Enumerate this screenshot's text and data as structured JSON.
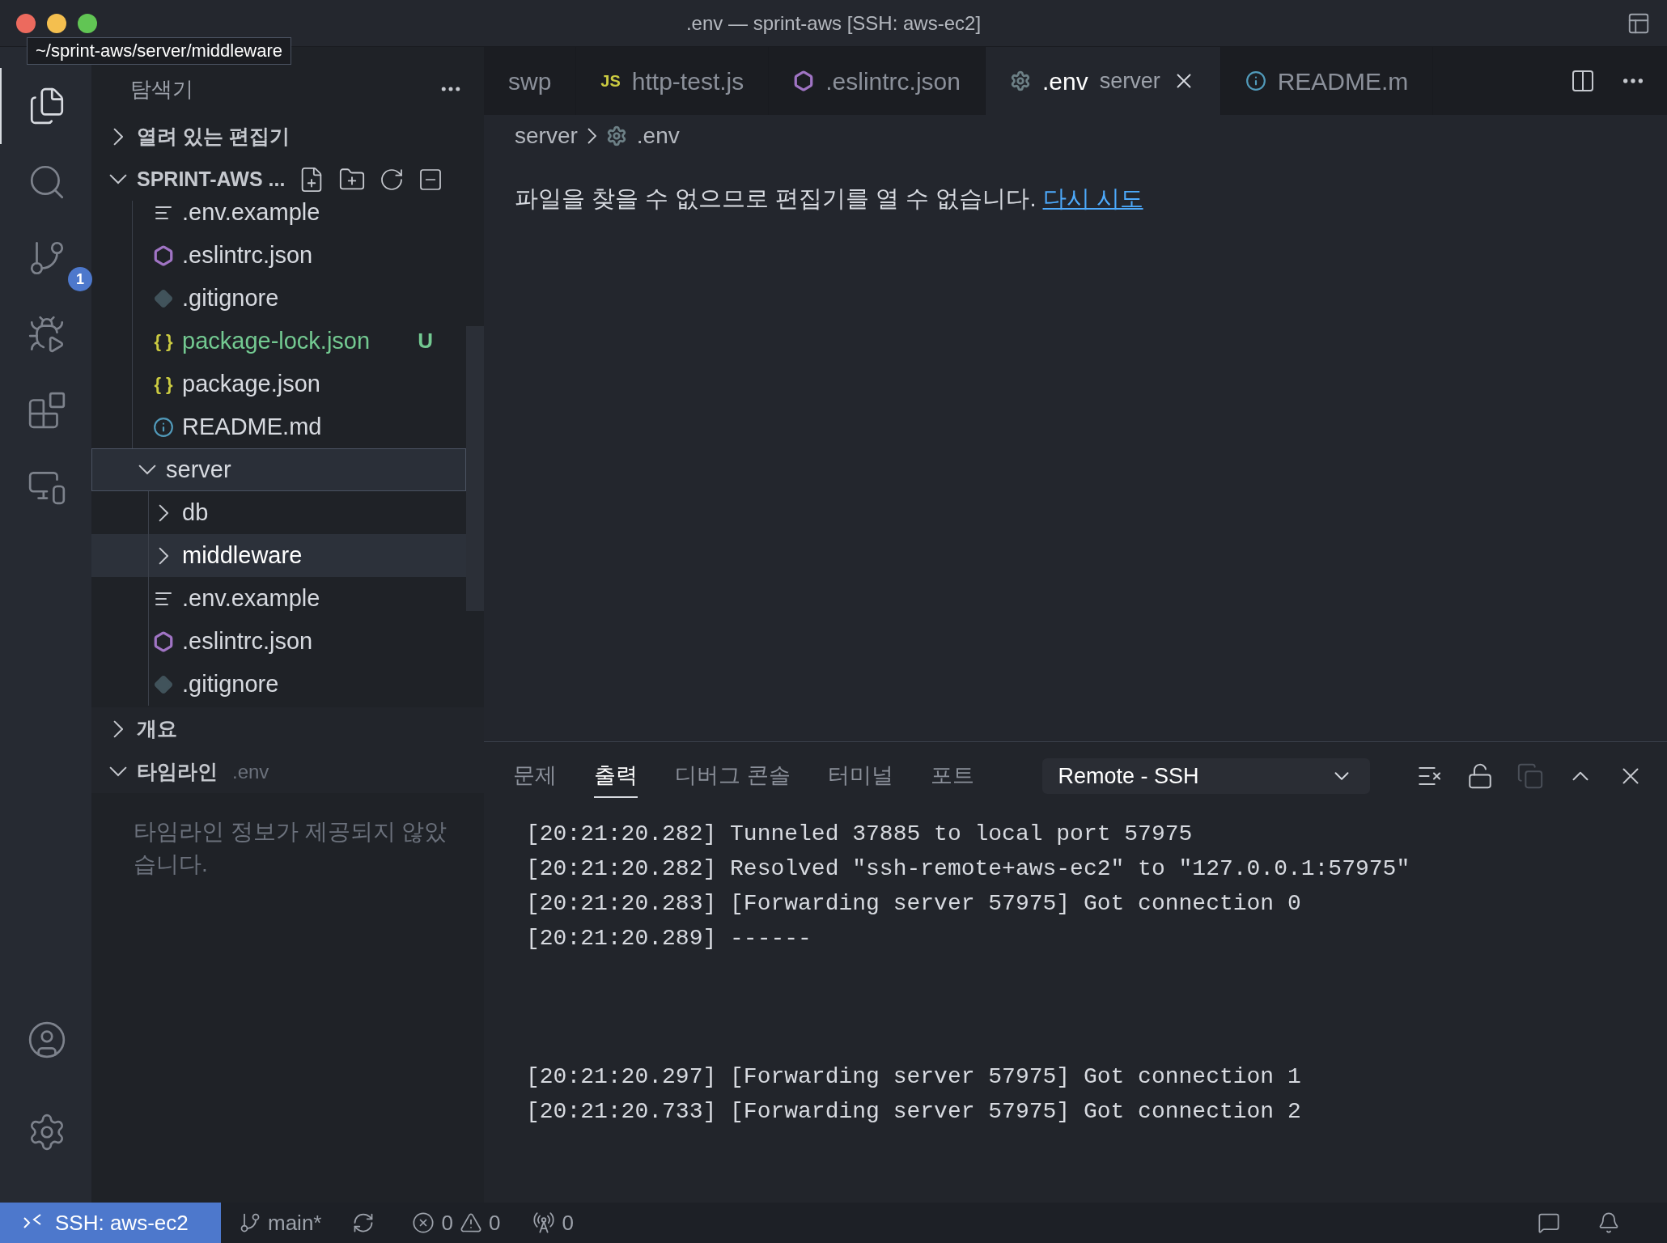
{
  "window": {
    "title": ".env — sprint-aws [SSH: aws-ec2]"
  },
  "tooltip": {
    "text": "~/sprint-aws/server/middleware"
  },
  "activity_bar": {
    "items": [
      {
        "kind": "explorer",
        "selected": true
      },
      {
        "kind": "search",
        "selected": false
      },
      {
        "kind": "source_control",
        "selected": false,
        "badge": "1"
      },
      {
        "kind": "run_debug",
        "selected": false
      },
      {
        "kind": "extensions",
        "selected": false
      },
      {
        "kind": "remote",
        "selected": false
      }
    ],
    "bottom": [
      {
        "kind": "account"
      },
      {
        "kind": "settings"
      }
    ]
  },
  "sidebar": {
    "title": "탐색기",
    "open_editors": {
      "label": "열려 있는 편집기",
      "expanded": false
    },
    "explorer": {
      "label": "SPRINT-AWS ...",
      "expanded": true,
      "partial_children": [
        {
          "name": ".env.example",
          "kind": "text",
          "selected": false,
          "focused": false
        },
        {
          "name": ".eslintrc.json",
          "kind": "eslint",
          "selected": false,
          "focused": false
        },
        {
          "name": ".gitignore",
          "kind": "git",
          "selected": false,
          "focused": false
        },
        {
          "name": "package-lock.json",
          "kind": "json",
          "icon_text": "{ }",
          "decoration": "U",
          "selected": false,
          "focused": false
        },
        {
          "name": "package.json",
          "kind": "json",
          "icon_text": "{ }",
          "selected": false,
          "focused": false
        },
        {
          "name": "README.md",
          "kind": "info",
          "selected": false,
          "focused": false
        }
      ],
      "tree": [
        {
          "name": "server",
          "kind": "folder",
          "expanded": true,
          "selected": false,
          "focused": true,
          "children": [
            {
              "name": "db",
              "kind": "folder",
              "expanded": false,
              "selected": false,
              "focused": false
            },
            {
              "name": "middleware",
              "kind": "folder",
              "expanded": false,
              "selected": true,
              "focused": false
            },
            {
              "name": ".env.example",
              "kind": "text",
              "selected": false,
              "focused": false
            },
            {
              "name": ".eslintrc.json",
              "kind": "eslint",
              "selected": false,
              "focused": false
            },
            {
              "name": ".gitignore",
              "kind": "git",
              "selected": false,
              "focused": false
            }
          ]
        }
      ]
    },
    "outline": {
      "label": "개요",
      "expanded": false
    },
    "timeline": {
      "label": "타임라인",
      "expanded": true,
      "subtitle": ".env",
      "message": "타임라인 정보가 제공되지 않았습니다."
    }
  },
  "tabs": [
    {
      "label": "swp",
      "kind": "plain",
      "selected": false
    },
    {
      "label": "http-test.js",
      "kind": "js",
      "icon_text": "JS",
      "selected": false
    },
    {
      "label": ".eslintrc.json",
      "kind": "eslint",
      "selected": false
    },
    {
      "label": ".env",
      "description": "server",
      "kind": "gear",
      "selected": true
    },
    {
      "label": "README.m",
      "kind": "info",
      "selected": false
    }
  ],
  "breadcrumb": [
    {
      "label": "server",
      "kind": "plain"
    },
    {
      "label": ".env",
      "kind": "gear"
    }
  ],
  "editor": {
    "message": "파일을 찾을 수 없으므로 편집기를 열 수 없습니다.",
    "link": "다시 시도"
  },
  "panel": {
    "tabs": [
      {
        "label": "문제",
        "selected": false
      },
      {
        "label": "출력",
        "selected": true
      },
      {
        "label": "디버그 콘솔",
        "selected": false
      },
      {
        "label": "터미널",
        "selected": false
      },
      {
        "label": "포트",
        "selected": false
      }
    ],
    "channel": "Remote - SSH",
    "actions": [
      {
        "kind": "clear",
        "disabled": false
      },
      {
        "kind": "lock",
        "disabled": false
      },
      {
        "kind": "copy",
        "disabled": true
      },
      {
        "kind": "maximize",
        "disabled": false
      },
      {
        "kind": "close",
        "disabled": false
      }
    ],
    "output": [
      {
        "lines": [
          "[20:21:20.282] Tunneled 37885 to local port 57975",
          "[20:21:20.282] Resolved \"ssh-remote+aws-ec2\" to \"127.0.0.1:57975\"",
          "[20:21:20.283] [Forwarding server 57975] Got connection 0",
          "[20:21:20.289] ------"
        ]
      },
      {
        "lines": [
          "[20:21:20.297] [Forwarding server 57975] Got connection 1",
          "[20:21:20.733] [Forwarding server 57975] Got connection 2"
        ]
      }
    ]
  },
  "status_bar": {
    "remote": "SSH: aws-ec2",
    "branch": "main*",
    "errors": "0",
    "warnings": "0",
    "ports": "0"
  }
}
